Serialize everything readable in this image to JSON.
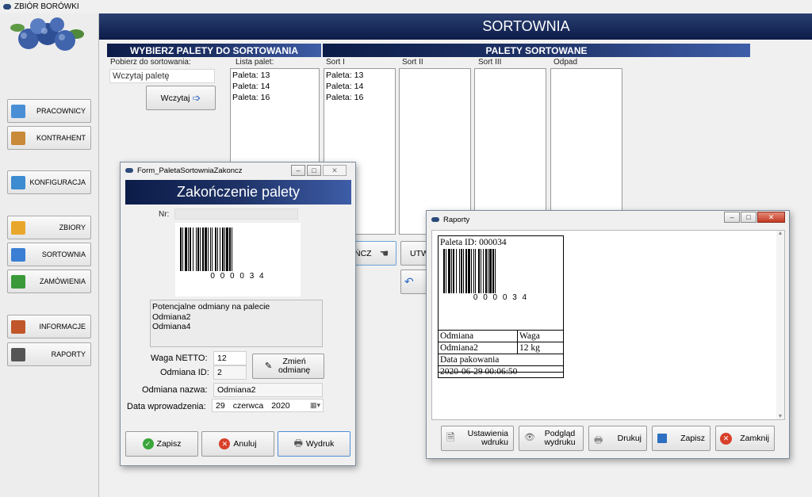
{
  "app": {
    "title": "ZBIÓR BORÓWKI"
  },
  "sidebar": {
    "items": [
      {
        "label": "PRACOWNICY",
        "icon": "people-icon",
        "color": "#4a8fd6"
      },
      {
        "label": "KONTRAHENT",
        "icon": "contact-card-icon",
        "color": "#c98a3a"
      },
      {
        "label": "KONFIGURACJA",
        "icon": "gears-icon",
        "color": "#3d8bd0"
      },
      {
        "label": "ZBIORY",
        "icon": "inbox-download-icon",
        "color": "#e8a72a"
      },
      {
        "label": "SORTOWNIA",
        "icon": "funnel-icon",
        "color": "#3a7fd4"
      },
      {
        "label": "ZAMÓWIENIA",
        "icon": "truck-icon",
        "color": "#3a9a3a"
      },
      {
        "label": "INFORMACJE",
        "icon": "briefcase-icon",
        "color": "#c0562a"
      },
      {
        "label": "RAPORTY",
        "icon": "chart-icon",
        "color": "#555555"
      }
    ]
  },
  "header": {
    "title": "SORTOWNIA"
  },
  "select": {
    "title": "WYBIERZ PALETY DO SORTOWANIA",
    "fetch_label": "Pobierz do sortowania:",
    "input_placeholder": "Wczytaj paletę",
    "load_button": "Wczytaj",
    "list_label": "Lista palet:",
    "pallets": [
      "Paleta: 13",
      "Paleta: 14",
      "Paleta: 16"
    ]
  },
  "sorted": {
    "title": "PALETY SORTOWANE",
    "cols": [
      {
        "label": "Sort I",
        "items": [
          "Paleta: 13",
          "Paleta: 14",
          "Paleta: 16"
        ]
      },
      {
        "label": "Sort II",
        "items": []
      },
      {
        "label": "Sort III",
        "items": []
      },
      {
        "label": "Odpad",
        "items": []
      }
    ],
    "partial_button_1": "ŃCZ",
    "partial_button_2": "UTW"
  },
  "form": {
    "window_title": "Form_PaletaSortowniaZakoncz",
    "heading": "Zakończenie palety",
    "nr_label": "Nr:",
    "barcode_digits": "0 0 0 0 3 4",
    "varieties_text": [
      "Potencjalne odmiany na palecie",
      "Odmiana2",
      "Odmiana4"
    ],
    "weight_label": "Waga NETTO:",
    "weight_value": "12",
    "variety_id_label": "Odmiana ID:",
    "variety_id_value": "2",
    "change_button": "Zmień odmianę",
    "variety_name_label": "Odmiana nazwa:",
    "variety_name_value": "Odmiana2",
    "date_label": "Data wprowadzenia:",
    "date_day": "29",
    "date_month": "czerwca",
    "date_year": "2020",
    "save_button": "Zapisz",
    "cancel_button": "Anuluj",
    "print_button": "Wydruk"
  },
  "report": {
    "window_title": "Raporty",
    "pallet_id": "Paleta ID: 000034",
    "barcode_digits": "0 0 0 0 3 4",
    "col_variety": "Odmiana",
    "col_weight": "Waga",
    "variety": "Odmiana2",
    "weight": "12 kg",
    "pack_date_label": "Data pakowania",
    "pack_date": "2020-06-29 00:06:50",
    "btn_settings": "Ustawienia wdruku",
    "btn_preview": "Podgląd wydruku",
    "btn_print": "Drukuj",
    "btn_save": "Zapisz",
    "btn_close": "Zamknij"
  }
}
